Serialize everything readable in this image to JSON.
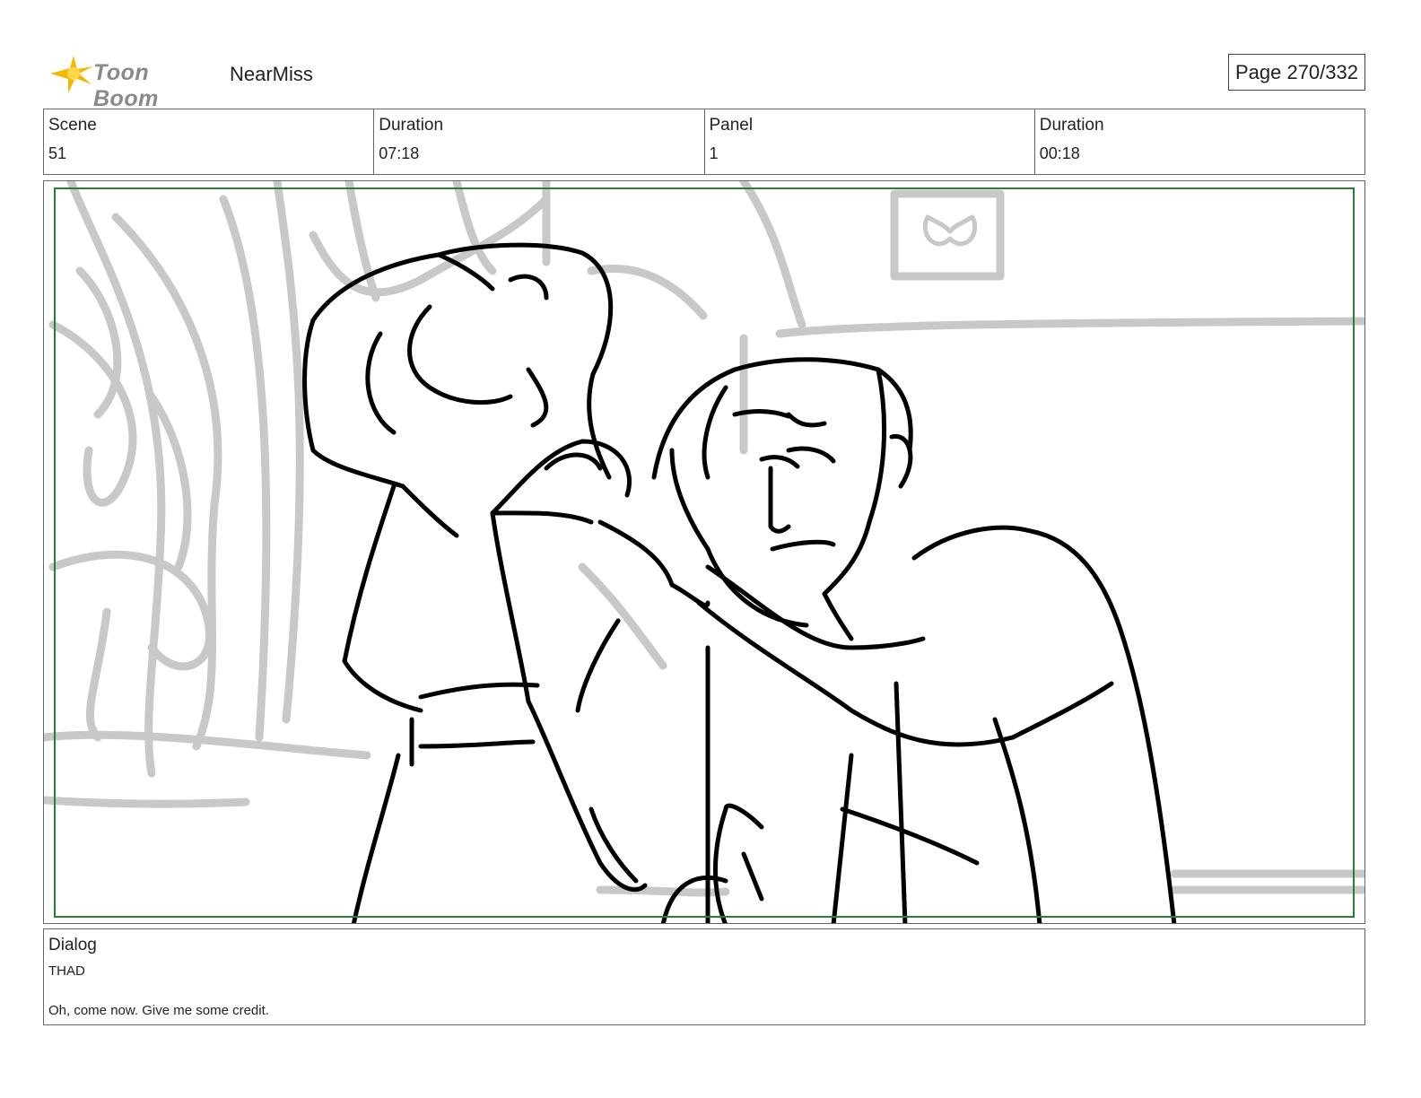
{
  "header": {
    "logo_text": "Toon Boom",
    "project_title": "NearMiss",
    "page_label": "Page 270/332"
  },
  "info": {
    "scene_label": "Scene",
    "scene_value": "51",
    "scene_duration_label": "Duration",
    "scene_duration_value": "07:18",
    "panel_label": "Panel",
    "panel_value": "1",
    "panel_duration_label": "Duration",
    "panel_duration_value": "00:18"
  },
  "dialog": {
    "label": "Dialog",
    "speaker": "THAD",
    "line": "Oh, come now. Give me some credit."
  },
  "colors": {
    "safe_frame": "#2e7d32",
    "background_sketch": "#c8c8c8",
    "foreground_sketch": "#000000",
    "logo_star": "#f5b800"
  }
}
